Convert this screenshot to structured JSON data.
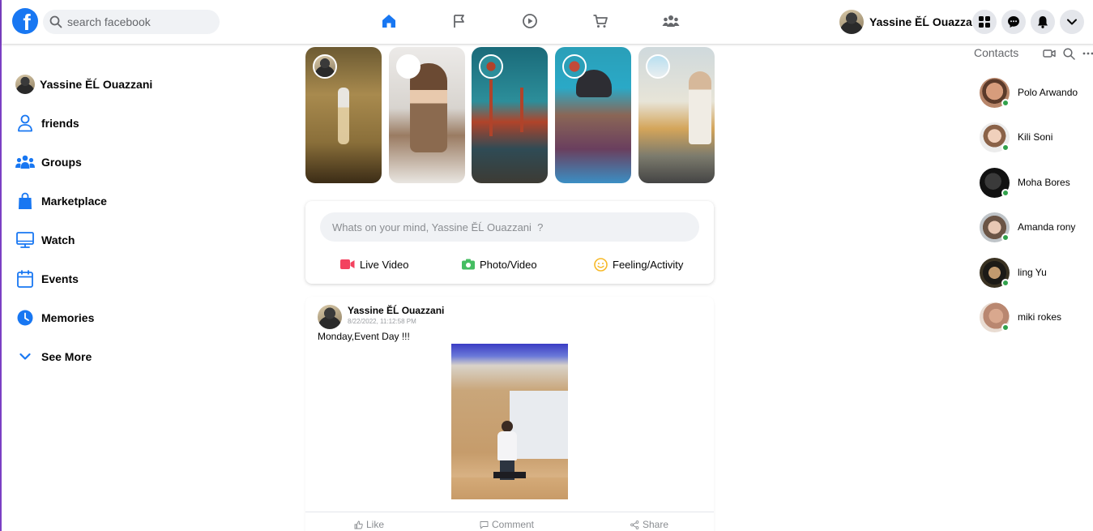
{
  "header": {
    "search_placeholder": "search facebook",
    "user_name": "Yassine ĔĹ Ouazzani",
    "brand_color": "#1877f2",
    "nav_icons": [
      "home-icon",
      "flag-icon",
      "watch-icon",
      "marketplace-icon",
      "groups-icon"
    ],
    "action_icons": [
      "menu-grid-icon",
      "messenger-icon",
      "notifications-icon",
      "chevron-down-icon"
    ]
  },
  "sidebar": {
    "items": [
      {
        "label": "Yassine ĔĹ Ouazzani",
        "icon": "avatar"
      },
      {
        "label": "friends",
        "icon": "friends-icon"
      },
      {
        "label": "Groups",
        "icon": "groups-icon"
      },
      {
        "label": "Marketplace",
        "icon": "marketplace-icon"
      },
      {
        "label": "Watch",
        "icon": "watch-icon"
      },
      {
        "label": "Events",
        "icon": "calendar-icon"
      },
      {
        "label": "Memories",
        "icon": "clock-icon"
      },
      {
        "label": "See More",
        "icon": "chevron-down-icon"
      }
    ]
  },
  "composer": {
    "placeholder": "Whats on your mind, Yassine ĔĹ Ouazzani  ?",
    "live_video": "Live Video",
    "photo_video": "Photo/Video",
    "feeling": "Feeling/Activity"
  },
  "post": {
    "author": "Yassine ĔĹ Ouazzani",
    "date": "8/22/2022, 11:12:58 PM",
    "text": "Monday,Event Day !!!",
    "like": "Like",
    "comment": "Comment",
    "share": "Share"
  },
  "contacts": {
    "title": "Contacts",
    "online_color": "#31a24c",
    "items": [
      {
        "name": "Polo Arwando"
      },
      {
        "name": "Kili Soni"
      },
      {
        "name": "Moha Bores"
      },
      {
        "name": "Amanda rony"
      },
      {
        "name": "ling Yu"
      },
      {
        "name": "miki rokes"
      }
    ]
  }
}
